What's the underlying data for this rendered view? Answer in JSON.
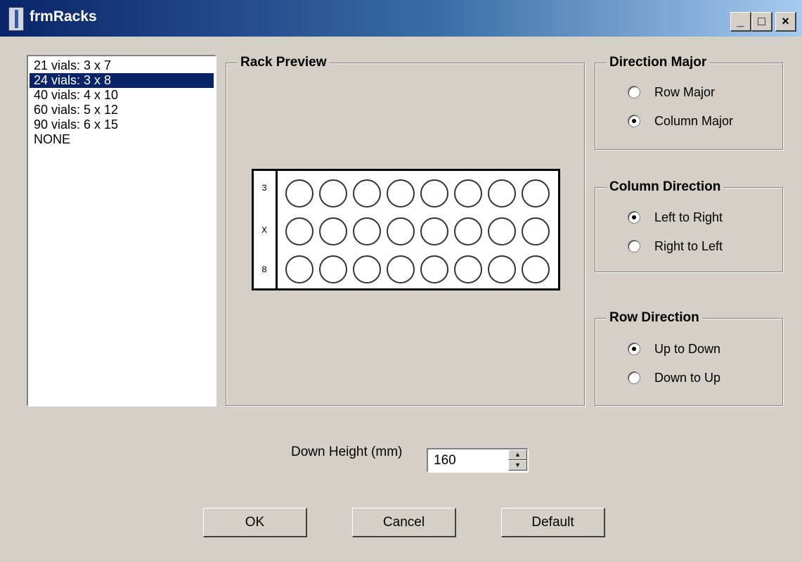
{
  "window": {
    "title": "frmRacks",
    "minimize_glyph": "_",
    "maximize_glyph": "□",
    "close_glyph": "×"
  },
  "rack_list": {
    "items": [
      {
        "label": "21 vials: 3 x 7",
        "selected": false
      },
      {
        "label": "24 vials: 3 x 8",
        "selected": true
      },
      {
        "label": "40 vials: 4 x 10",
        "selected": false
      },
      {
        "label": "60 vials: 5 x 12",
        "selected": false
      },
      {
        "label": "90 vials: 6 x 15",
        "selected": false
      },
      {
        "label": "NONE",
        "selected": false
      }
    ]
  },
  "rack_preview": {
    "title": "Rack Preview",
    "side_labels": [
      "3",
      "X",
      "8"
    ],
    "rows": 3,
    "columns": 8
  },
  "direction_major": {
    "title": "Direction Major",
    "options": [
      {
        "label": "Row Major",
        "checked": false
      },
      {
        "label": "Column Major",
        "checked": true
      }
    ]
  },
  "column_direction": {
    "title": "Column Direction",
    "options": [
      {
        "label": "Left to Right",
        "checked": true
      },
      {
        "label": "Right to Left",
        "checked": false
      }
    ]
  },
  "row_direction": {
    "title": "Row Direction",
    "options": [
      {
        "label": "Up to Down",
        "checked": true
      },
      {
        "label": "Down to Up",
        "checked": false
      }
    ]
  },
  "down_height": {
    "label": "Down Height (mm)",
    "value": "160"
  },
  "buttons": {
    "ok": "OK",
    "cancel": "Cancel",
    "default": "Default"
  },
  "colors": {
    "face": "#d4d0c8",
    "title_start": "#0a246a",
    "title_end": "#a6caf0",
    "selection": "#0a246a"
  }
}
